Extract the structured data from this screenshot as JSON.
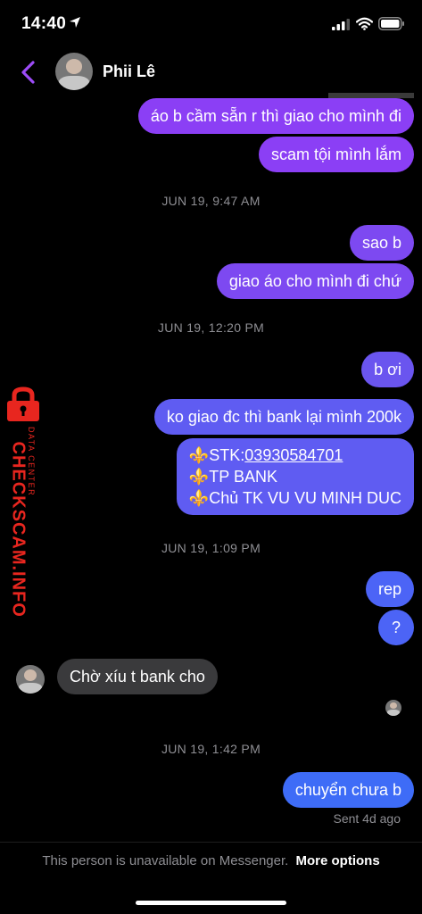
{
  "status_bar": {
    "time": "14:40"
  },
  "header": {
    "contact_name": "Phii Lê"
  },
  "messages": [
    {
      "text": "áo b cầm sẵn r thì giao cho mình đi"
    },
    {
      "text": "scam tội mình lắm"
    },
    {
      "text": "sao b"
    },
    {
      "text": "giao áo cho mình đi chứ"
    },
    {
      "text": "b ơi"
    },
    {
      "text": "ko giao đc thì bank lại mình 200k"
    },
    {
      "lines": [
        "⚜️STK:",
        "03930584701",
        "⚜️TP BANK",
        "⚜️Chủ TK VU VU MINH DUC"
      ]
    },
    {
      "text": "rep"
    },
    {
      "text": "?"
    },
    {
      "text": "Chờ xíu t bank cho"
    },
    {
      "text": "chuyển chưa b"
    }
  ],
  "timestamps": [
    "JUN 19, 9:47 AM",
    "JUN 19, 12:20 PM",
    "JUN 19, 1:09 PM",
    "JUN 19, 1:42 PM"
  ],
  "sent_status": "Sent 4d ago",
  "footer": {
    "notice": "This person is unavailable on Messenger.",
    "link": "More options"
  },
  "watermark": {
    "main": "CHECKSCAM.INFO",
    "sub": "DATA CENTER"
  },
  "colors": {
    "accent": "#8b3ff5",
    "incoming": "#3a3a3c",
    "watermark": "#e8261f"
  }
}
